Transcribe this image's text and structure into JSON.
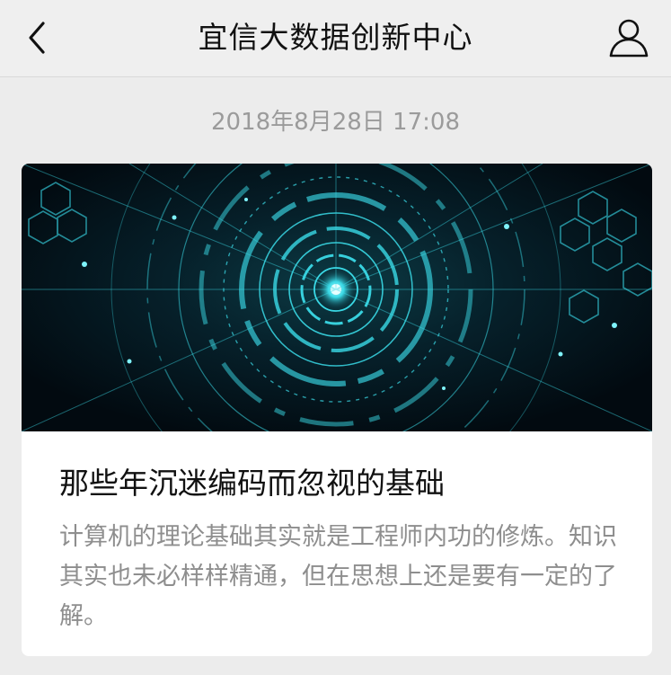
{
  "header": {
    "title": "宜信大数据创新中心",
    "back_icon": "chevron-left-icon",
    "profile_icon": "person-icon"
  },
  "message": {
    "timestamp": "2018年8月28日 17:08"
  },
  "article_card": {
    "cover_image": "circuit-eye-illustration",
    "title": "那些年沉迷编码而忽视的基础",
    "description": "计算机的理论基础其实就是工程师内功的修炼。知识其实也未必样样精通，但在思想上还是要有一定的了解。"
  },
  "colors": {
    "background": "#ececec",
    "card": "#ffffff",
    "accent_cyan": "#3ad9e6"
  }
}
